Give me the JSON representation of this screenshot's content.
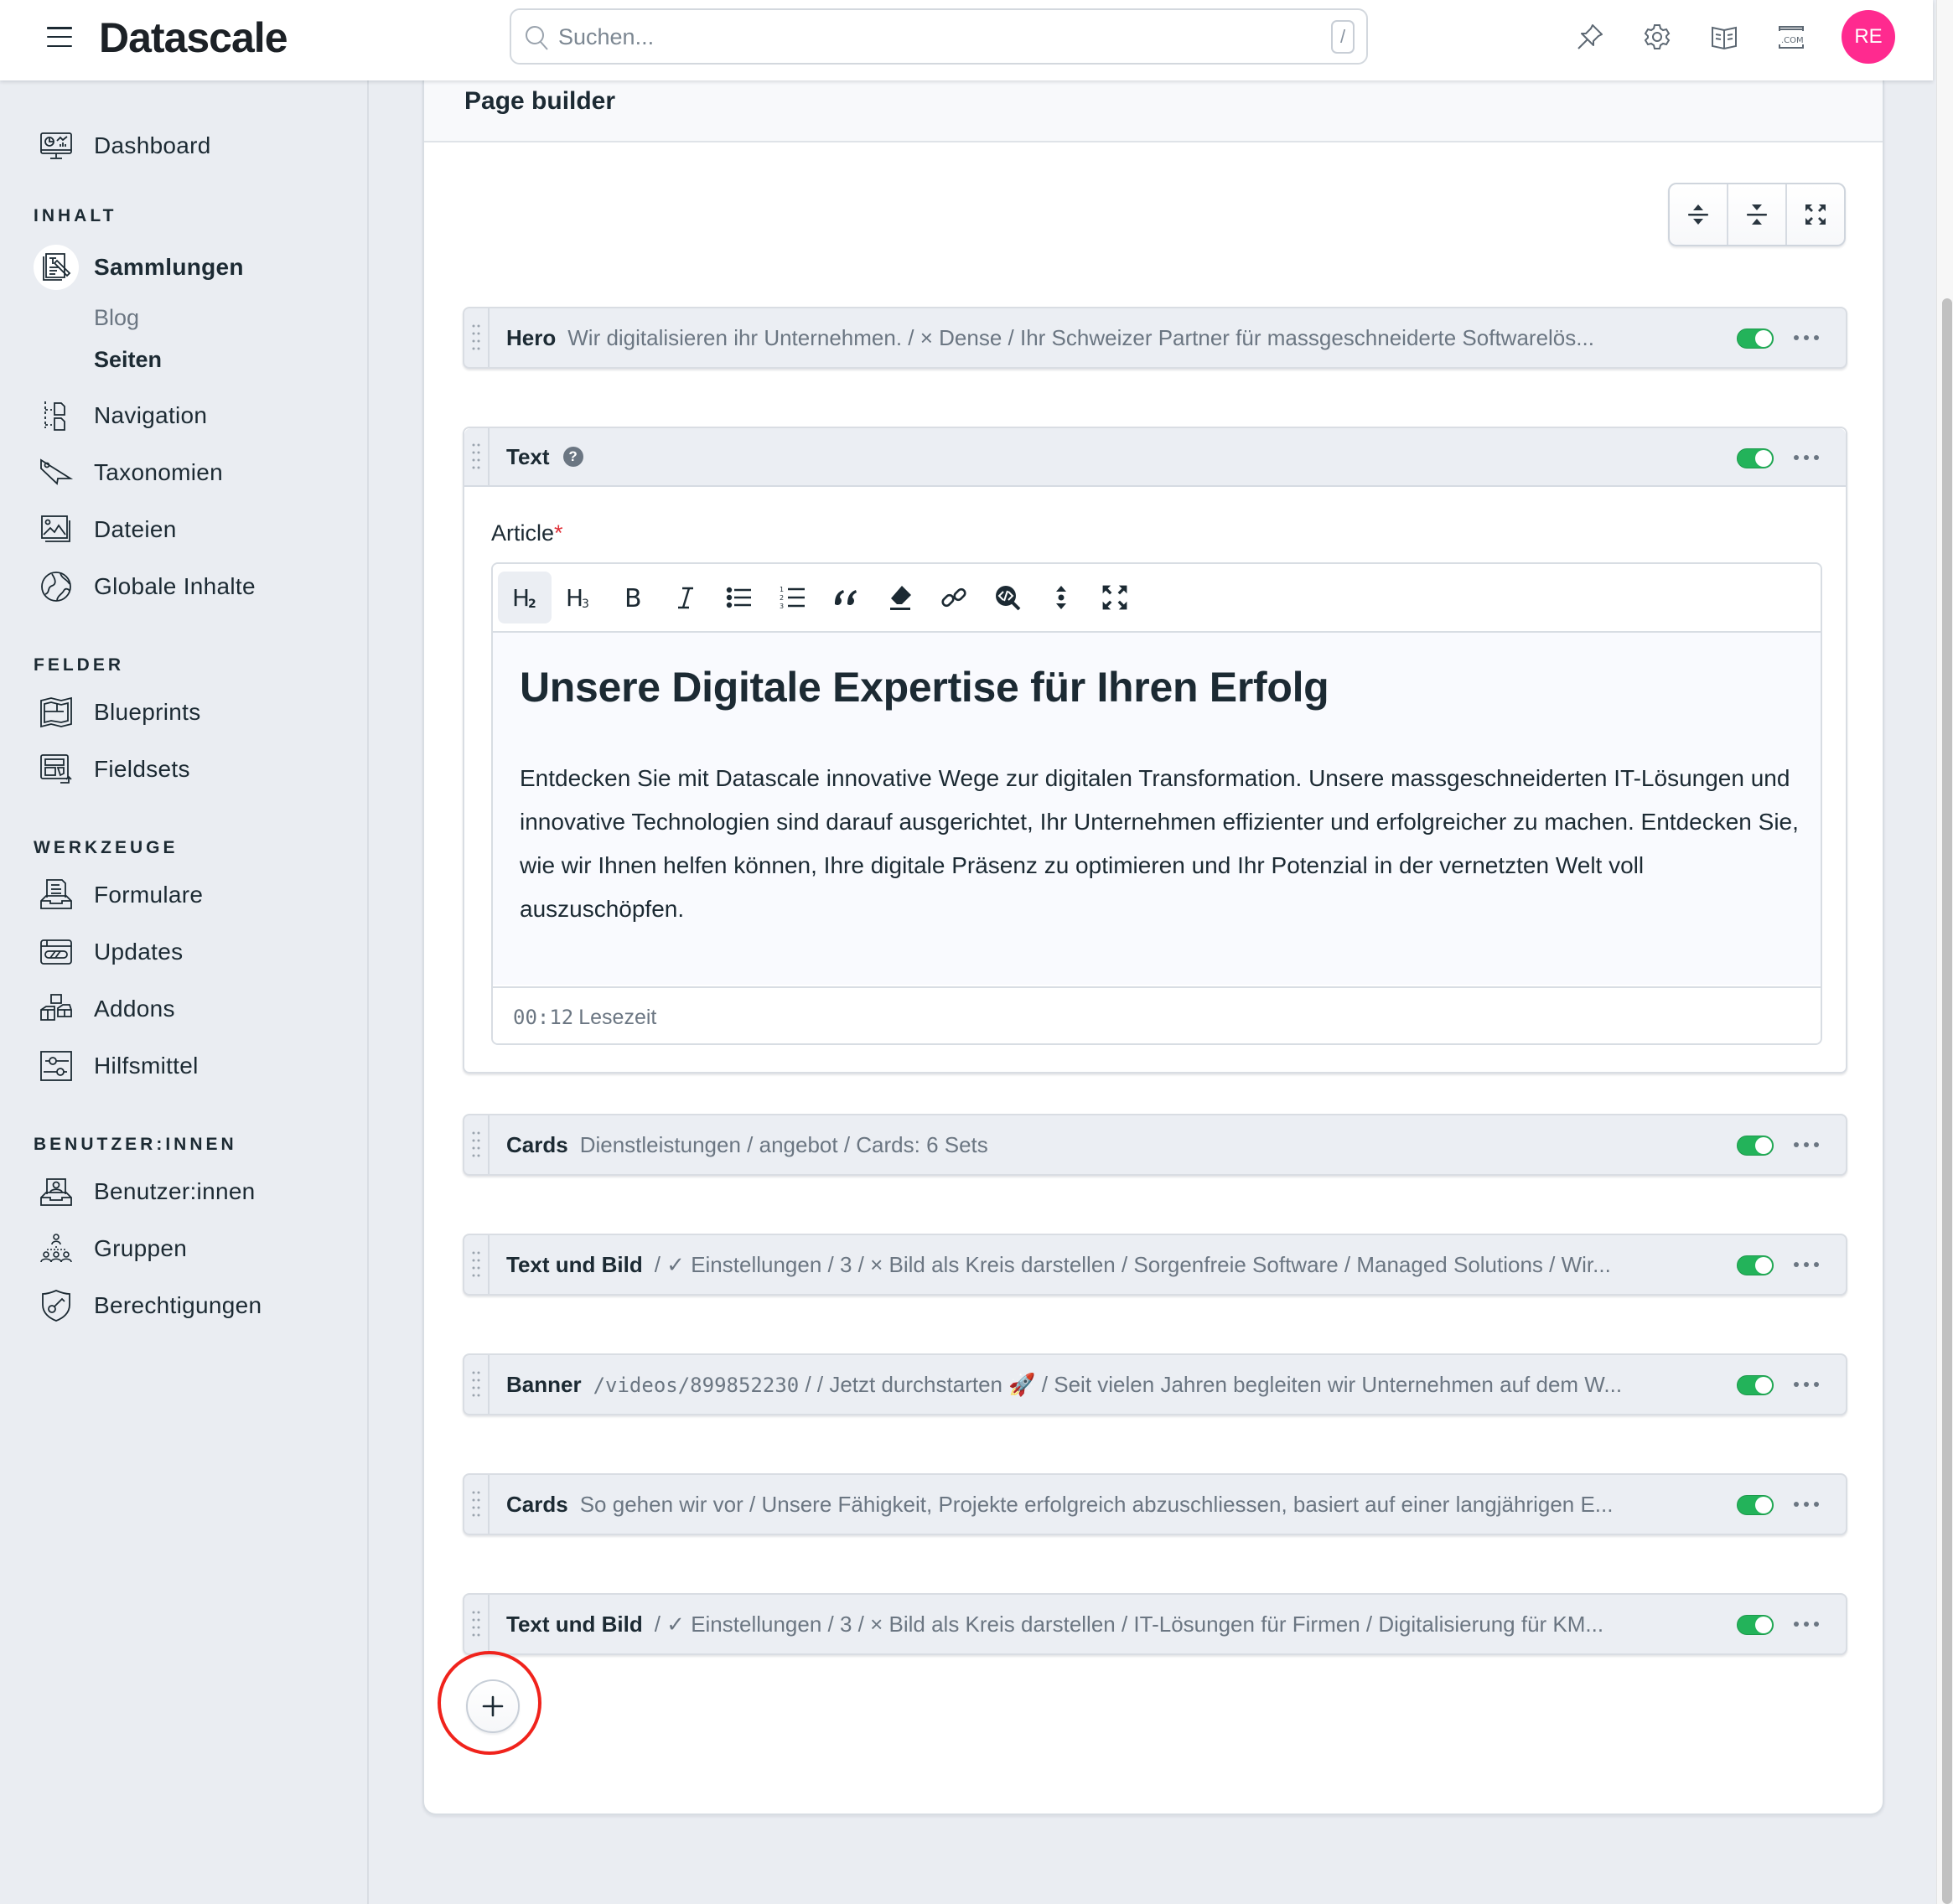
{
  "app": {
    "brand": "Datascale",
    "search": {
      "placeholder": "Suchen...",
      "value": "",
      "shortcut": "/"
    },
    "top_icons": [
      "pin-icon",
      "gear-icon",
      "book-icon",
      "domain-icon"
    ],
    "avatar_initials": "RE",
    "avatar_color": "#ff2a8f"
  },
  "sidebar": {
    "dashboard": "Dashboard",
    "sections": [
      {
        "title": "INHALT",
        "items": [
          "Sammlungen",
          "Navigation",
          "Taxonomien",
          "Dateien",
          "Globale Inhalte"
        ]
      },
      {
        "title": "FELDER",
        "items": [
          "Blueprints",
          "Fieldsets"
        ]
      },
      {
        "title": "WERKZEUGE",
        "items": [
          "Formulare",
          "Updates",
          "Addons",
          "Hilfsmittel"
        ]
      },
      {
        "title": "BENUTZER:INNEN",
        "items": [
          "Benutzer:innen",
          "Gruppen",
          "Berechtigungen"
        ]
      }
    ],
    "sammlungen_sub": [
      "Blog",
      "Seiten"
    ],
    "active_item": "Sammlungen",
    "active_sub": "Seiten"
  },
  "panel": {
    "title": "Page builder",
    "toolbar_buttons": [
      "expand-all",
      "collapse-all",
      "fullscreen"
    ],
    "sets": [
      {
        "name": "Hero",
        "summary": "Wir digitalisieren ihr Unternehmen. / × Dense / Ihr Schweizer Partner für massgeschneiderte Softwarelös...",
        "enabled": true
      },
      {
        "name": "Text",
        "enabled": true,
        "expanded": true
      },
      {
        "name": "Cards",
        "summary": "Dienstleistungen / angebot / Cards: 6 Sets",
        "enabled": true
      },
      {
        "name": "Text und Bild",
        "summary": "/ ✓ Einstellungen / 3 / × Bild als Kreis darstellen / Sorgenfreie Software / Managed Solutions / Wir...",
        "enabled": true
      },
      {
        "name": "Banner",
        "summary_prefix": "/videos/899852230",
        "summary": " / / Jetzt durchstarten 🚀 / Seit vielen Jahren begleiten wir Unternehmen auf dem W...",
        "enabled": true
      },
      {
        "name": "Cards",
        "summary": "So gehen wir vor / Unsere Fähigkeit, Projekte erfolgreich abzuschliessen, basiert auf einer langjährigen E...",
        "enabled": true
      },
      {
        "name": "Text und Bild",
        "summary": "/ ✓ Einstellungen / 3 / × Bild als Kreis darstellen / IT-Lösungen für Firmen / Digitalisierung für KM...",
        "enabled": true
      }
    ],
    "text_set": {
      "field_label": "Article",
      "required_mark": "*",
      "editor_tools": [
        "heading-2",
        "heading-3",
        "bold",
        "italic",
        "bullet-list",
        "ordered-list",
        "quote",
        "clear-format",
        "link",
        "code-search",
        "expand-vertical",
        "fullscreen"
      ],
      "active_tool": "heading-2",
      "heading": "Unsere Digitale Expertise für Ihren Erfolg",
      "paragraph": "Entdecken Sie mit Datascale innovative Wege zur digitalen Transformation. Unsere massgeschneiderten IT-Lösungen und innovative Technologien sind darauf ausgerichtet, Ihr Unternehmen effizienter und erfolgreicher zu machen. Entdecken Sie, wie wir Ihnen helfen können, Ihre digitale Präsenz zu optimieren und Ihr Potenzial in der vernetzten Welt voll auszuschöpfen.",
      "reading_time": "00:12",
      "reading_time_label": "Lesezeit"
    },
    "toggle_color": "#23b35a",
    "highlight_color": "#f0231c"
  }
}
